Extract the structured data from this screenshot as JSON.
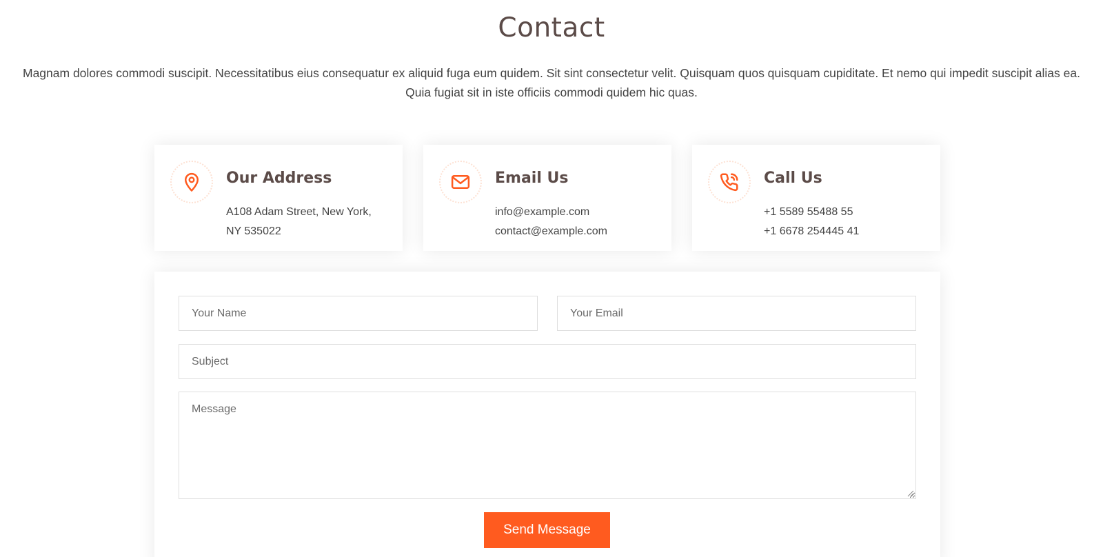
{
  "section": {
    "title": "Contact",
    "description": "Magnam dolores commodi suscipit. Necessitatibus eius consequatur ex aliquid fuga eum quidem. Sit sint consectetur velit. Quisquam quos quisquam cupiditate. Et nemo qui impedit suscipit alias ea. Quia fugiat sit in iste officiis commodi quidem hic quas."
  },
  "info_boxes": [
    {
      "icon": "map-pin-icon",
      "title": "Our Address",
      "line1": "A108 Adam Street, New York,",
      "line2": "NY 535022"
    },
    {
      "icon": "envelope-icon",
      "title": "Email Us",
      "line1": "info@example.com",
      "line2": "contact@example.com"
    },
    {
      "icon": "phone-icon",
      "title": "Call Us",
      "line1": "+1 5589 55488 55",
      "line2": "+1 6678 254445 41"
    }
  ],
  "form": {
    "name_placeholder": "Your Name",
    "email_placeholder": "Your Email",
    "subject_placeholder": "Subject",
    "message_placeholder": "Message",
    "submit_label": "Send Message"
  },
  "colors": {
    "accent": "#ff5b1f",
    "heading": "#5b4b48",
    "text": "#444444"
  }
}
